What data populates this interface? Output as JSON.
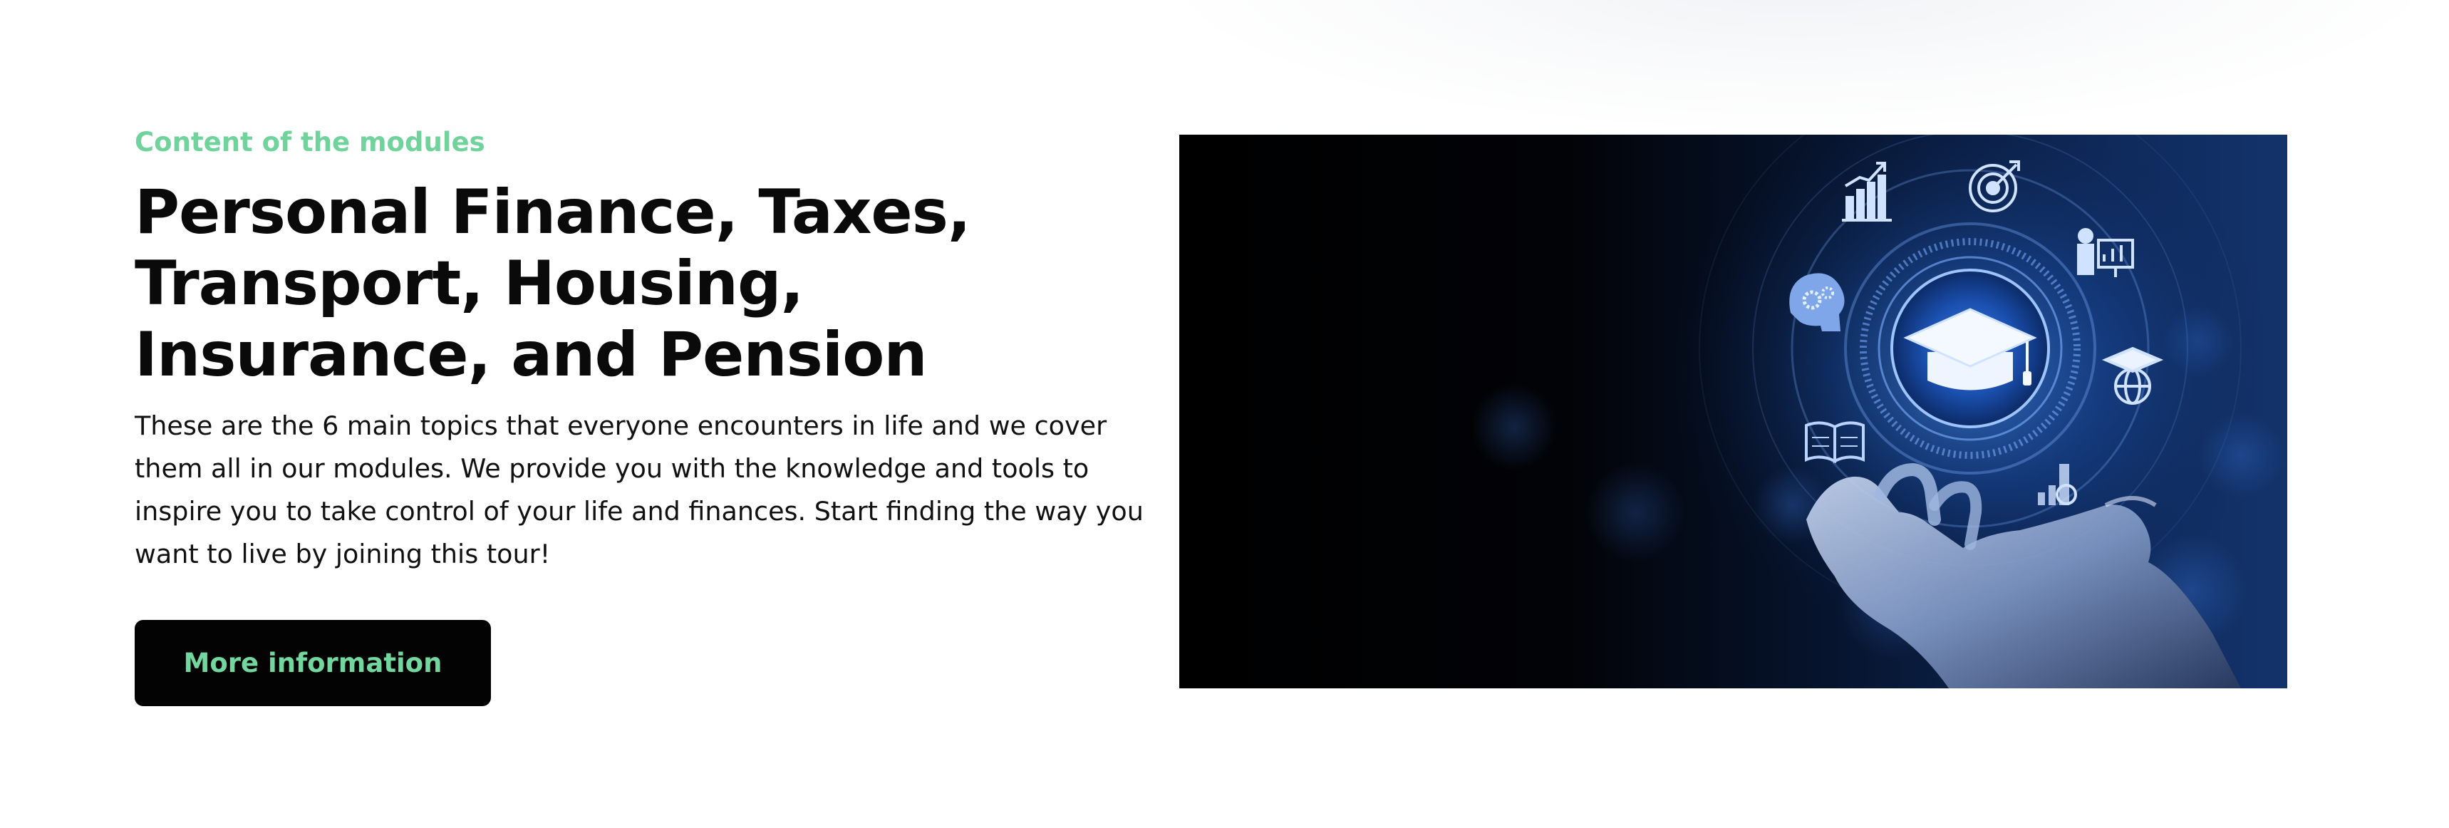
{
  "section": {
    "eyebrow": "Content of the modules",
    "title": "Personal Finance, Taxes, Transport, Housing, Insurance, and Pension",
    "description": "These are the 6 main topics that everyone encounters in life and we cover them all in our modules. We provide you with the knowledge and tools to inspire you to take control of your life and finances. Start finding the way you want to live by joining this tour!",
    "cta_label": "More information"
  },
  "hero_image": {
    "icons": [
      "graduation-cap-icon",
      "growth-chart-icon",
      "target-icon",
      "presenter-icon",
      "mind-gears-icon",
      "globe-graduate-icon",
      "open-book-icon",
      "report-icon"
    ]
  },
  "colors": {
    "accent": "#6fd39b",
    "button_bg": "#030303",
    "text": "#0a0a0a",
    "hero_glow": "#2f6fd6"
  }
}
